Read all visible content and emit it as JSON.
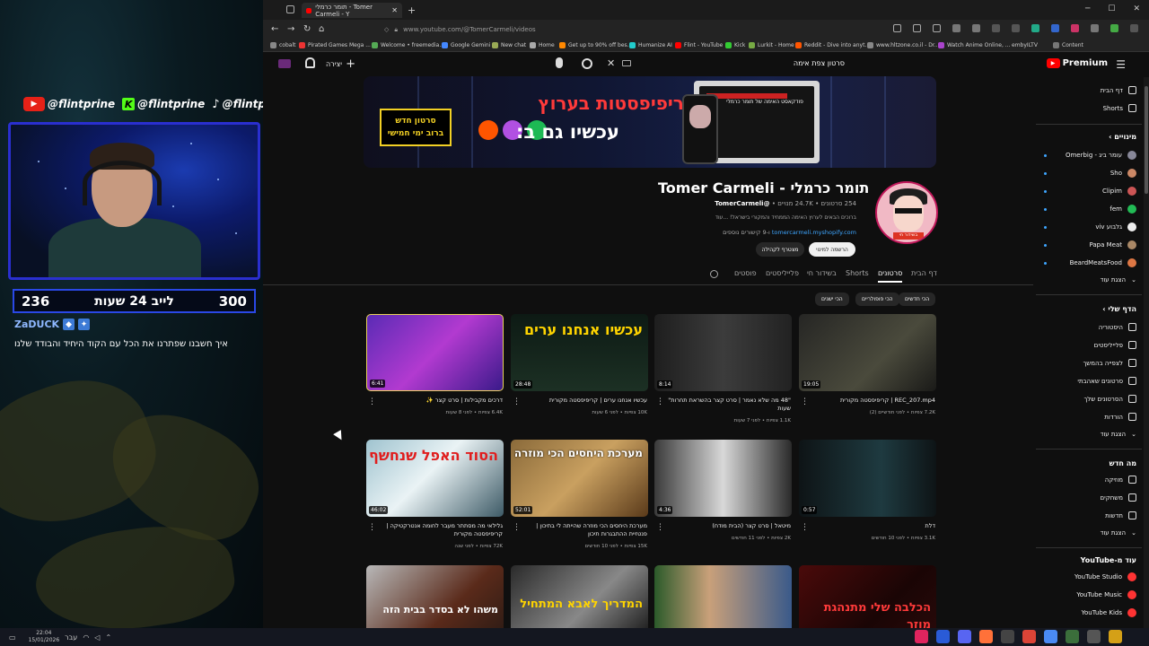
{
  "stream": {
    "socials": [
      {
        "handle": "@flintprine",
        "icon": "youtube-icon"
      },
      {
        "handle": "@flintprine",
        "icon": "kick-icon"
      },
      {
        "handle": "@flintprine",
        "icon": "tiktok-icon"
      }
    ],
    "counter_left": "236",
    "counter_title": "לייב 24 שעות",
    "counter_right": "300",
    "chat_user": "ZaDUCK",
    "chat_message": "איך חשבנו שפתרנו את הכל עם הקוד היחיד והבודד שלנו"
  },
  "taskbar": {
    "time": "22:04",
    "date": "15/01/2026",
    "lang": "עבר"
  },
  "browser": {
    "tab_title": "תומר כרמלי - Tomer Carmeli - Y",
    "url": "www.youtube.com/@TomerCarmeli/videos",
    "bookmarks": [
      "cobalt",
      "Pirated Games Mega ...",
      "Welcome • freemedia...",
      "Google Gemini",
      "New chat",
      "Home",
      "Get up to 90% off bes...",
      "Humanize AI",
      "Flint - YouTube",
      "Kick",
      "Lurkit - Home",
      "Reddit - Dive into anyt...",
      "www.hltzone.co.il - Dr...",
      "Watch Anime Online, ...",
      "embyILTV",
      "Content"
    ]
  },
  "youtube": {
    "logo": "Premium",
    "search_query": "סרטון צפת אימה",
    "create_label": "יצירה",
    "colors": {
      "brand": "#ff0000",
      "link": "#3ea6ff",
      "avatar_ring": "#c2185b"
    },
    "sidebar": {
      "home": "דף הבית",
      "shorts": "Shorts",
      "subs_heading": "מינויים",
      "subscriptions": [
        "עומר ביג - Omerbig",
        "Sho",
        "Clipim",
        "fem",
        "גלבוע viv",
        "Papa Meat",
        "BeardMeatsFood"
      ],
      "show_more": "הצגת עוד",
      "you_heading": "הדף שלי",
      "you_items": [
        "היסטוריה",
        "פלייליסטים",
        "לצפייה בהמשך",
        "סרטונים שאהבתי",
        "הסרטונים שלך",
        "הורדות"
      ],
      "show_more2": "הצגת עוד",
      "new_heading": "מה חדש",
      "new_items": [
        "מוזיקה",
        "משחקים",
        "חדשות"
      ],
      "show_more3": "הצגת עוד",
      "more_heading": "עוד מ-YouTube",
      "more_items": [
        "YouTube Studio",
        "YouTube Music",
        "YouTube Kids"
      ]
    },
    "banner": {
      "title": "כל הקריפיפסטות בערוץ",
      "subtitle": "עכשיו גם ב:",
      "badge_line1": "סרטון חדש",
      "badge_line2": "ברוב ימי חמישי",
      "mini_title": "פודקאסט האימה של תומר כרמלי"
    },
    "channel": {
      "name": "Tomer Carmeli - תומר כרמלי",
      "handle": "@TomerCarmeli",
      "subscribers": "24.7K מנויים",
      "videos_count": "254 סרטונים",
      "description": "ברוכים הבאים לערוץ האימה הממחיד והמקורי בישראל! ...עוד",
      "link": "tomercarmeli.myshopify.com",
      "link_more": "ו-9 קישורים נוספים",
      "subscribe_label": "הרשמה למינוי",
      "join_label": "מצטרף לקהילה",
      "avatar_tag": "בשידור חי"
    },
    "tabs": [
      "דף הבית",
      "סרטונים",
      "Shorts",
      "בשידור חי",
      "פלייליסטים",
      "פוסטים"
    ],
    "chips": [
      "הכי חדשים",
      "הכי פופולריים",
      "הכי ישנים"
    ],
    "videos": [
      {
        "title": "דרכים מקבילות | סרט קצר ✨",
        "meta": "6.4K צפיות • לפני 8 שעות",
        "duration": "6:41",
        "text": ""
      },
      {
        "title": "עכשיו אנחנו ערים | קריפיפסטה מקורית",
        "meta": "10K צפיות • לפני 6 שעות",
        "duration": "28:48",
        "text": "עכשיו אנחנו ערים"
      },
      {
        "title": "\"48 מה שלא נאמר | סרט קצר בהשראת תחרות\" שעות",
        "meta": "1.1K צפיות • לפני 7 שעות",
        "duration": "8:14",
        "text": ""
      },
      {
        "title": "REC_207.mp4 | קריפיפסטה מקורית",
        "meta": "7.2K צפיות • לפני חודשיים (2)",
        "duration": "19:05",
        "text": ""
      },
      {
        "title": "גלילאי מה מסתתר מעבר לחומה אנטרקטיקה | קריפיפסטה מקורית",
        "meta": "72K צפיות • לפני שנה",
        "duration": "46:02",
        "text": "הסוד האפל שנחשף"
      },
      {
        "title": "מערכת היחסים הכי מוזרה שהייתה לי בתיכון | פנטזיית ההתבגרות תיכון",
        "meta": "15K צפיות • לפני 10 חודשים",
        "duration": "52:01",
        "text": "מערכת היחסים הכי מוזרה"
      },
      {
        "title": "מיטאל | סרט קצר (הבית מודח)",
        "meta": "2K צפיות • לפני 11 חודשים",
        "duration": "4:36",
        "text": ""
      },
      {
        "title": "דלת",
        "meta": "3.1K צפיות • לפני 10 חודשים",
        "duration": "0:57",
        "text": ""
      },
      {
        "title": "",
        "meta": "",
        "duration": "",
        "text": "משהו לא בסדר בבית הזה"
      },
      {
        "title": "",
        "meta": "",
        "duration": "",
        "text": "המדריך לאבא המתחיל"
      },
      {
        "title": "",
        "meta": "",
        "duration": "",
        "text": ""
      },
      {
        "title": "",
        "meta": "",
        "duration": "",
        "text": "הכלבה שלי מתנהגת מוזר"
      }
    ]
  }
}
